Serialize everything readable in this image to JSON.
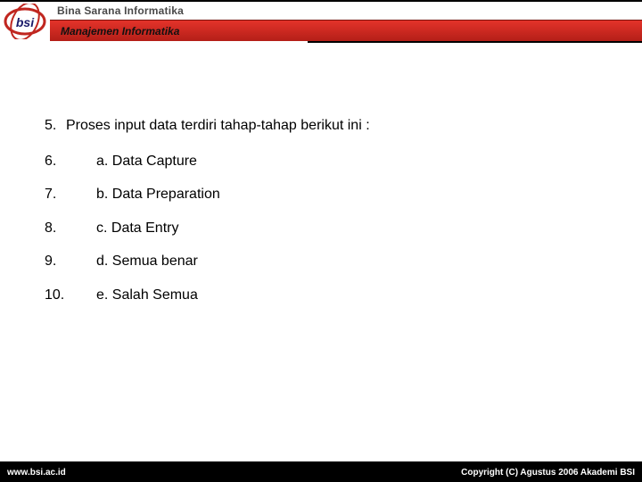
{
  "header": {
    "org_name": "Bina Sarana Informatika",
    "dept_name": "Manajemen Informatika"
  },
  "question": {
    "number": "5.",
    "text": "Proses input data terdiri tahap-tahap berikut ini :"
  },
  "options": [
    {
      "num": "6.",
      "text": "a. Data Capture"
    },
    {
      "num": "7.",
      "text": "b. Data Preparation"
    },
    {
      "num": "8.",
      "text": "c. Data Entry"
    },
    {
      "num": "9.",
      "text": "d. Semua benar"
    },
    {
      "num": "10.",
      "text": "e. Salah Semua"
    }
  ],
  "footer": {
    "left": "www.bsi.ac.id",
    "right": "Copyright (C) Agustus 2006 Akademi BSI"
  }
}
